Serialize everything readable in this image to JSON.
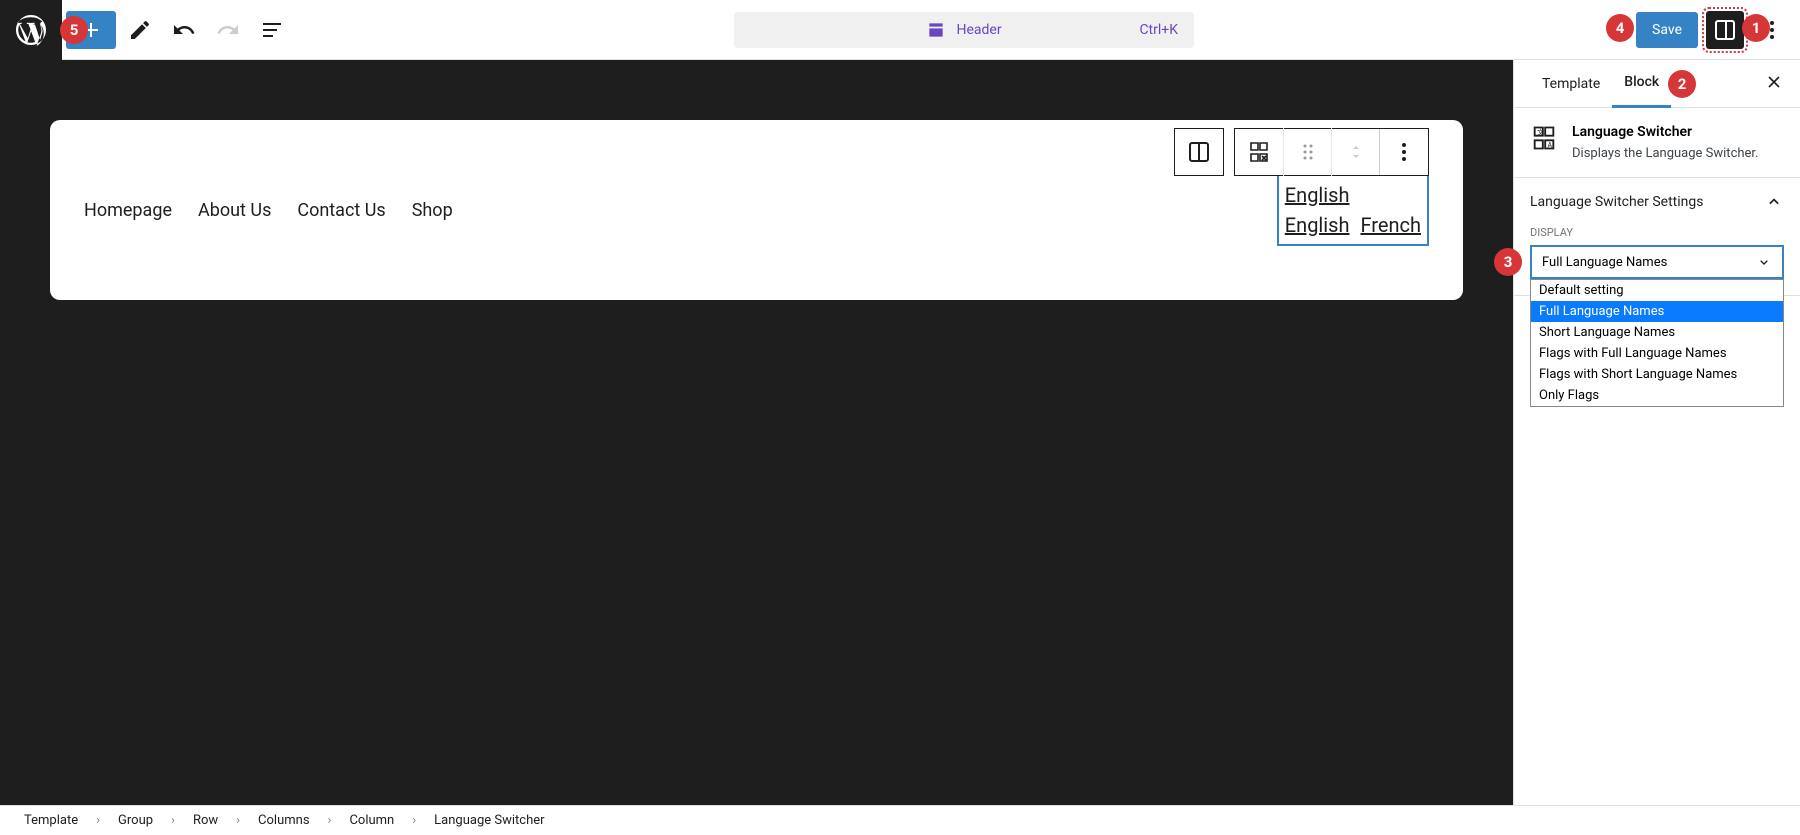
{
  "topbar": {
    "document_title": "Header",
    "document_shortcut": "Ctrl+K",
    "save_label": "Save"
  },
  "nav": [
    "Homepage",
    "About Us",
    "Contact Us",
    "Shop"
  ],
  "lang_switcher": {
    "line1": "English",
    "line2_a": "English",
    "line2_b": "French"
  },
  "sidebar": {
    "tabs": [
      "Template",
      "Block"
    ],
    "block_title": "Language Switcher",
    "block_desc": "Displays the Language Switcher.",
    "panel_title": "Language Switcher Settings",
    "field_label": "DISPLAY",
    "select_value": "Full Language Names",
    "dropdown_options": [
      "Default setting",
      "Full Language Names",
      "Short Language Names",
      "Flags with Full Language Names",
      "Flags with Short Language Names",
      "Only Flags"
    ]
  },
  "breadcrumb": [
    "Template",
    "Group",
    "Row",
    "Columns",
    "Column",
    "Language Switcher"
  ],
  "callouts": {
    "1": "1",
    "2": "2",
    "3": "3",
    "4": "4",
    "5": "5"
  }
}
